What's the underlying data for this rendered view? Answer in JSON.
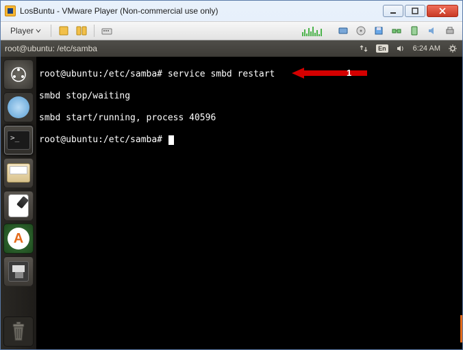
{
  "window": {
    "title": "LosBuntu - VMware Player (Non-commercial use only)"
  },
  "vmware": {
    "player_label": "Player"
  },
  "ubuntu_panel": {
    "title": "root@ubuntu: /etc/samba",
    "lang": "En",
    "time": "6:24 AM"
  },
  "launcher": {
    "items": [
      {
        "name": "ubuntu-dash"
      },
      {
        "name": "chromium-browser"
      },
      {
        "name": "terminal"
      },
      {
        "name": "file-manager"
      },
      {
        "name": "text-editor"
      },
      {
        "name": "software-updater"
      },
      {
        "name": "floppy-drive"
      }
    ],
    "trash": {
      "name": "trash"
    }
  },
  "terminal": {
    "lines": [
      "root@ubuntu:/etc/samba# service smbd restart",
      "smbd stop/waiting",
      "smbd start/running, process 40596",
      "root@ubuntu:/etc/samba# "
    ]
  },
  "callout": {
    "label": "1"
  }
}
